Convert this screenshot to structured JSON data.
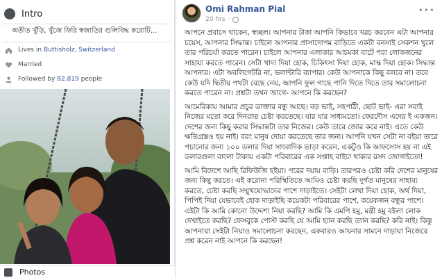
{
  "intro": {
    "title": "Intro",
    "icon": "globe-icon",
    "bio": "অতীত খুঁড়ি, খুঁজে ফিরি স্বজাতির গুলিবিদ্ধ করোটি...",
    "lives_in_prefix": "Lives in",
    "lives_in_place": "Buttisholz, Switzerland",
    "relationship": "Married",
    "followed_prefix": "Followed by",
    "followers_count": "82,819",
    "followed_suffix": "people"
  },
  "photos": {
    "label": "Photos",
    "icon": "photos-icon"
  },
  "post": {
    "author": "Omi Rahman Pial",
    "time": "20 hrs",
    "separator": "·",
    "more_icon": "ellipsis-icon",
    "paragraphs": [
      "আপনে প্রবাসে থাকেন, স্বচ্ছল। আপনার টাকা আপনি কিভাবে খরচ করবেন এটা আপনার চয়েস, আপনার সিদ্ধান্ত। চাইলে আপনার প্রাসাদোপম বাড়িতে একটা বনসাই সেকশন খুলে তার পরিচর্যা করতে পারেন। চাইলে আপনার এলাকার আচমকা বাটে পরা লোকজনের সাহায্য করতে পারেন। সেটা খাদ্য দিয়া হোক, চিকিৎসা দিয়া হোক, মাস্ক দিয়া হোক। সিদ্ধান্ত আপনার। এটা অবলিগেটরি না, ভলান্টারি ব্যাপার। কেউ আপনাকে কিছু বলবে না। তবে কেউ যদি দ্বিতীয় পথটা বেছে নেয়, আপনি ফুল গাছে পানি দিতে দিতে তার সমালোচনা করতে পারেন না। প্রশ্নটা তখন জাগে- আপনে কি করছেন?",
      "আমেরিকায় আমার প্রচুর ডাক্তার বন্ধু আছে। বড় ভাই, সহপাঠী, ছোট ভাই- এরা সবাই নিজের মতো করে দিনরাত চেষ্টা করতেছে। যার যার সাধ্যমতো। ফেরদৌস এদের ই একজন। দেশের জন্য কিছু করার সিদ্ধান্তটা তার নিজের। কেউ তারে জোর করে নাই। এতে কেউ ক্ষতিগ্রস্তও হয় নাই। বরং মানুষ দোয়া করতেছে তার জন্য। আপনি যখন সেটা না বইয়া তারে পচানোর জন্য ১০০ ডলার দিয়া সাংবাদিক ভাড়া করেন, একটুও কি আফসোস হয় না এই ডলারগুলা বাংলা টাকায় একটা পরিবারের এক সপ্তাহ বাইচা থাকার রসদ জোগাইতো!",
      "আমি বিদেশে আছি রিফিউজি হইয়া। পরের দয়ায় বাড়ি। তারপরও চেষ্টা করি দেশের মানুষের জন্য কিছু করতে। এই করোনা পরিস্থিতিতে আমিও চেষ্টা করছি দুর্গত মানুষের সাহায্য করতে, চেষ্টা করছি সম্মুখযোদ্ধাদের পাশে দাড়াইতে। সেইটা লেখা দিয়া হোক, অর্থ দিয়া, পিপিই দিয়া যেভাবেই হোক দাড়াইছি কয়েকটা পরিবারের পাশে, কয়েকজন বন্ধুর পাশে। এইটা কি আমি কোনো উদ্দেশ্য নিয়া করছি? আমি কি এমপি হমু, মন্ত্রী হমু বইলা লোক দেখাইতে করছি? ফেসবুকে পোস্ট করছি যে আমি হ্যান করছি ত্যান করছি? করি নাই। কিন্তু আপনারা সেইটা নিয়াও সমালোচনা করছেন, একবারও আয়নার সামনে দাড়ায়া নিজেরে প্রশ্ন করেন নাই আপনে কি করছেন!"
    ]
  }
}
